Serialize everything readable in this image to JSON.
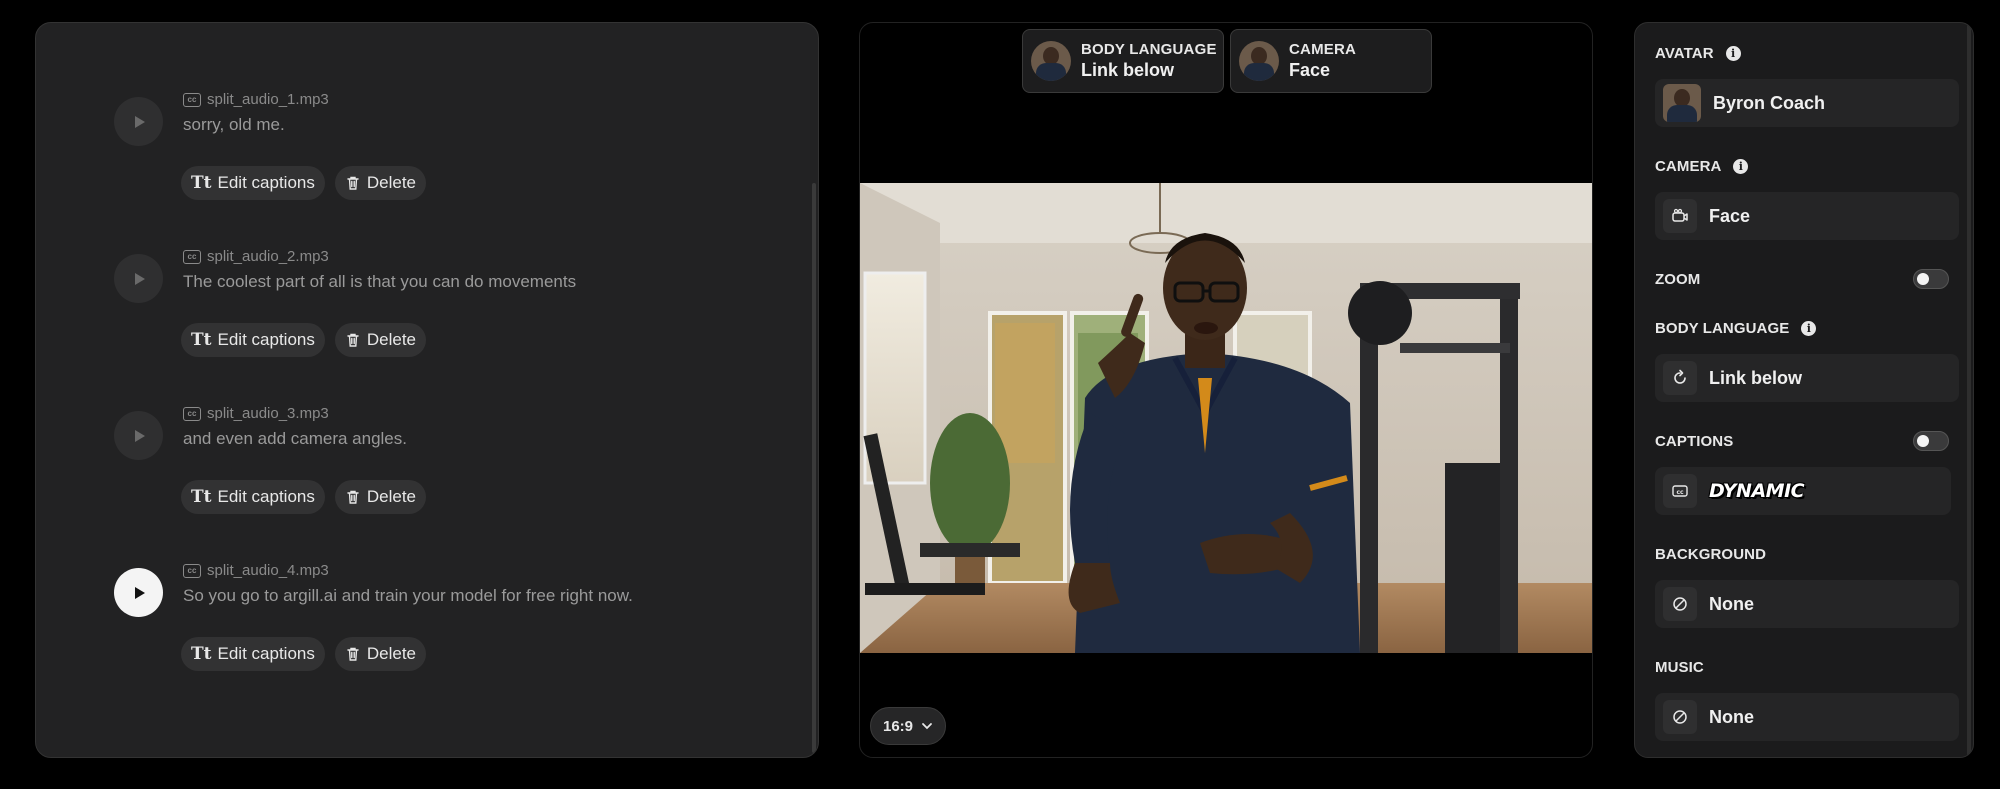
{
  "clips": [
    {
      "file": "split_audio_1.mp3",
      "text": "sorry, old me.",
      "active": false
    },
    {
      "file": "split_audio_2.mp3",
      "text": "The coolest part of all is that you can do movements",
      "active": false
    },
    {
      "file": "split_audio_3.mp3",
      "text": "and even add camera angles.",
      "active": false
    },
    {
      "file": "split_audio_4.mp3",
      "text": "So you go to argill.ai and train your model for free right now.",
      "active": true
    }
  ],
  "clip_actions": {
    "edit_captions": "Edit captions",
    "delete": "Delete",
    "tt_glyph": "Tt",
    "cc_glyph": "cc"
  },
  "top_chips": [
    {
      "title": "BODY LANGUAGE",
      "value": "Link below"
    },
    {
      "title": "CAMERA",
      "value": "Face"
    }
  ],
  "aspect_ratio": "16:9",
  "settings": {
    "avatar": {
      "label": "AVATAR",
      "value": "Byron Coach"
    },
    "camera": {
      "label": "CAMERA",
      "value": "Face"
    },
    "zoom": {
      "label": "ZOOM",
      "enabled": false
    },
    "body_language": {
      "label": "BODY LANGUAGE",
      "value": "Link below"
    },
    "captions": {
      "label": "CAPTIONS",
      "enabled": false,
      "style": "DYNAMIC"
    },
    "background": {
      "label": "BACKGROUND",
      "value": "None"
    },
    "music": {
      "label": "MUSIC",
      "value": "None"
    }
  },
  "icons": {
    "info": "i"
  },
  "colors": {
    "panel_bg": "#222223",
    "right_panel_bg": "#1b1b1c",
    "page_bg": "#000000",
    "accent_white": "#f4f4f4"
  }
}
